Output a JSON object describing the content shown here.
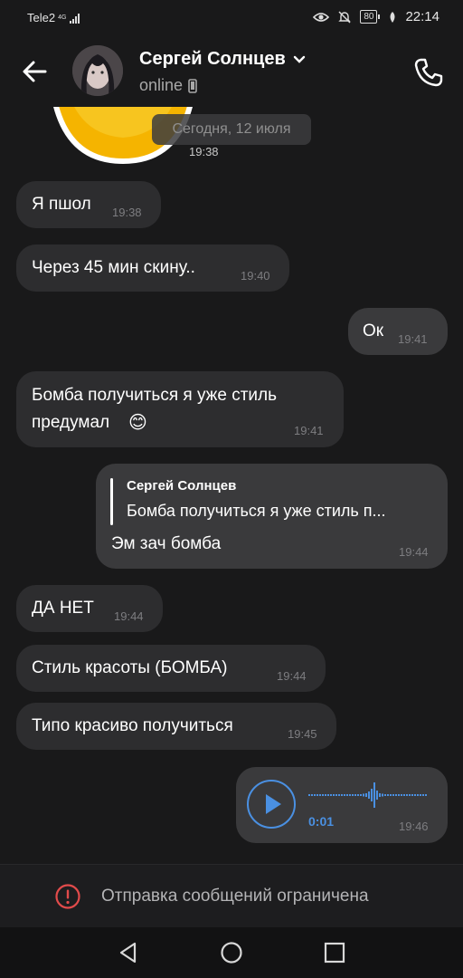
{
  "status_bar": {
    "carrier": "Tele2",
    "network": "4G",
    "battery": "80",
    "time": "22:14"
  },
  "header": {
    "contact_name": "Сергей Солнцев",
    "status": "online"
  },
  "chat": {
    "date_label": "Сегодня, 12 июля",
    "sticker_time": "19:38",
    "messages": [
      {
        "text": "Я пшол",
        "time": "19:38"
      },
      {
        "text": "Через 45 мин скину..",
        "time": "19:40"
      },
      {
        "text": "Ок",
        "time": "19:41"
      },
      {
        "line1": "Бомба получиться я уже стиль",
        "line2": "предумал",
        "emoji": "😊",
        "time": "19:41"
      },
      {
        "reply_author": "Сергей Солнцев",
        "reply_text": "Бомба получиться я уже стиль п...",
        "text": "Эм зач бомба",
        "time": "19:44"
      },
      {
        "text": "ДА НЕТ",
        "time": "19:44"
      },
      {
        "text": "Стиль красоты (БОМБА)",
        "time": "19:44"
      },
      {
        "text": "Типо красиво получиться",
        "time": "19:45"
      },
      {
        "voice_duration": "0:01",
        "time": "19:46"
      }
    ]
  },
  "footer": {
    "notice": "Отправка сообщений ограничена"
  },
  "icons": {
    "back": "arrow-left-icon",
    "phone": "phone-icon",
    "warning": "warning-circle-icon",
    "play": "play-icon",
    "nav_back": "triangle-back-icon",
    "nav_home": "circle-home-icon",
    "nav_recents": "square-recents-icon"
  },
  "colors": {
    "background": "#19191a",
    "bubble_in": "#2d2d2f",
    "bubble_out": "#3a3a3c",
    "accent_blue": "#4a90e2",
    "warning_red": "#e24b4b",
    "sticker_yellow": "#f5b400"
  }
}
